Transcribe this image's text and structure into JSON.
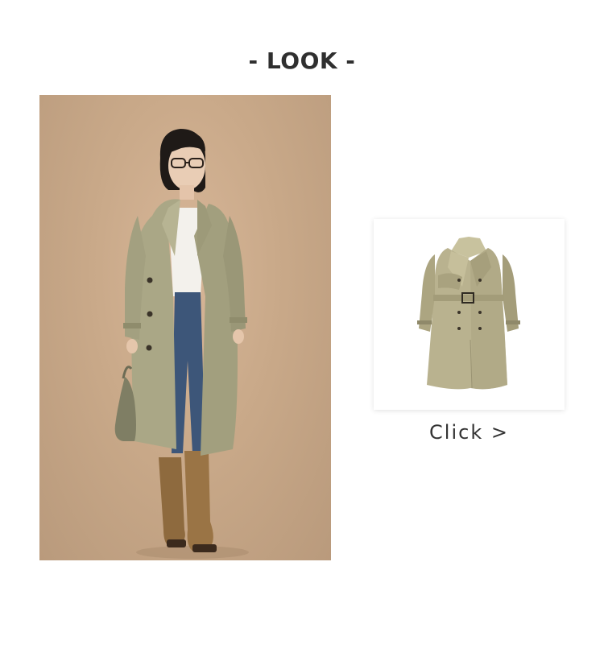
{
  "header": {
    "title": "- LOOK -"
  },
  "look": {
    "photo_subject": "model-in-trench-coat-photo",
    "background_color": "#c9a989"
  },
  "product": {
    "image_subject": "trench-coat-product-image",
    "coat_color": "#b9b28f",
    "link_label": "Click >"
  }
}
